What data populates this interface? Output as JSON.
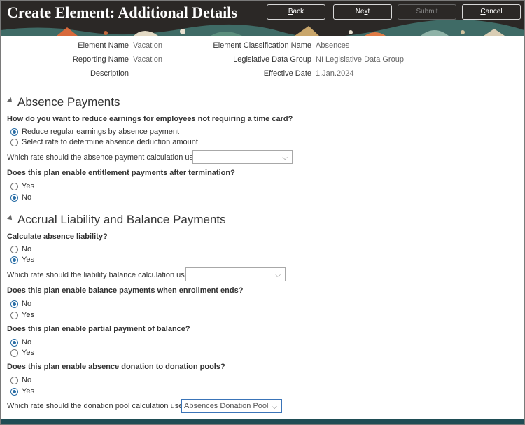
{
  "header": {
    "title": "Create Element: Additional Details",
    "buttons": {
      "back": {
        "prefix": "",
        "key": "B",
        "suffix": "ack"
      },
      "next": {
        "prefix": "Ne",
        "key": "x",
        "suffix": "t"
      },
      "submit": "Submit",
      "cancel": {
        "prefix": "",
        "key": "C",
        "suffix": "ancel"
      }
    }
  },
  "details": {
    "element_name_label": "Element Name",
    "element_name_value": "Vacation",
    "reporting_name_label": "Reporting Name",
    "reporting_name_value": "Vacation",
    "description_label": "Description",
    "classification_label": "Element Classification Name",
    "classification_value": "Absences",
    "ldg_label": "Legislative Data Group",
    "ldg_value": "NI Legislative Data Group",
    "effective_date_label": "Effective Date",
    "effective_date_value": "1.Jan.2024"
  },
  "absence_payments": {
    "title": "Absence Payments",
    "q1": "How do you want to reduce earnings for employees not requiring a time card?",
    "q1_opt1": "Reduce regular earnings by absence payment",
    "q1_opt2": "Select rate to determine absence deduction amount",
    "rate_label": "Which rate should the absence payment calculation use?",
    "rate_value": "",
    "q2": "Does this plan enable entitlement payments after termination?",
    "q2_opt1": "Yes",
    "q2_opt2": "No"
  },
  "accrual": {
    "title": "Accrual Liability and Balance Payments",
    "q1": "Calculate absence liability?",
    "q1_opt1": "No",
    "q1_opt2": "Yes",
    "liability_rate_label": "Which rate should the liability balance calculation use?",
    "liability_rate_value": "",
    "q2": "Does this plan enable balance payments when enrollment ends?",
    "q2_opt1": "No",
    "q2_opt2": "Yes",
    "q3": "Does this plan enable partial payment of balance?",
    "q3_opt1": "No",
    "q3_opt2": "Yes",
    "q4": "Does this plan enable absence donation to donation pools?",
    "q4_opt1": "No",
    "q4_opt2": "Yes",
    "donation_rate_label": "Which rate should the donation pool calculation use?",
    "donation_rate_value": "Absences Donation Pool"
  },
  "colors": {
    "header_bg": "#2b2826",
    "radio_selected": "#2a6ea6",
    "bottom_bar": "#1f4d55"
  }
}
